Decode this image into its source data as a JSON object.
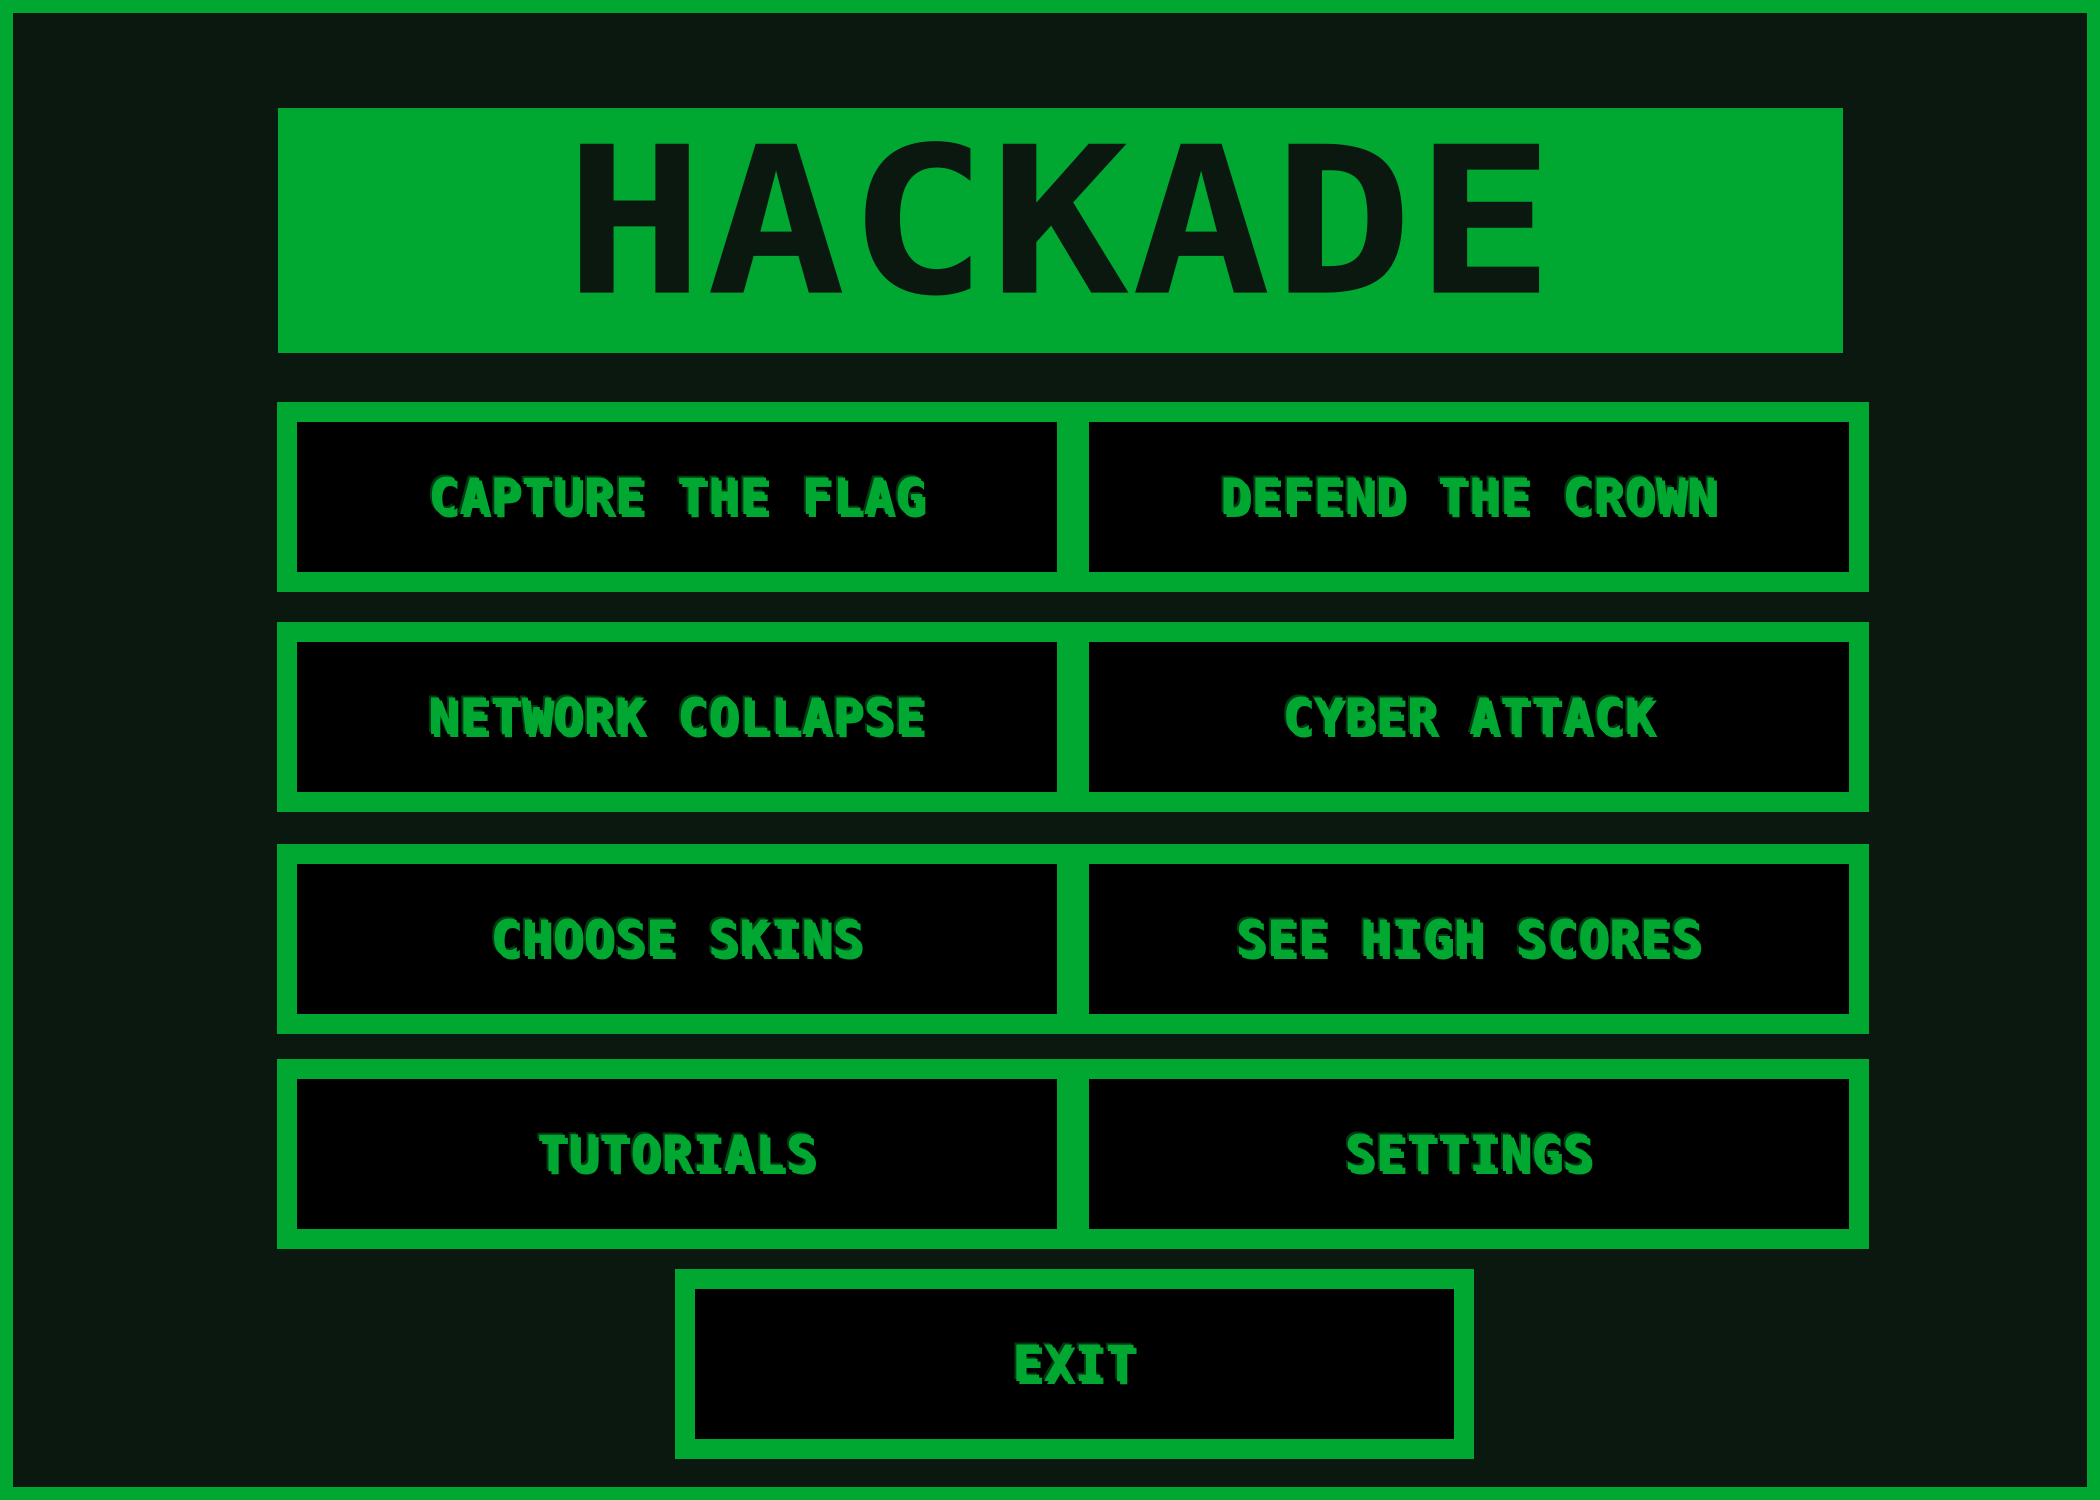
{
  "title": "HACKADE",
  "colors": {
    "accent": "#00a832",
    "background": "#0a1810",
    "button_fill": "#000000"
  },
  "menu": {
    "buttons": [
      {
        "label": "CAPTURE THE FLAG"
      },
      {
        "label": "DEFEND THE CROWN"
      },
      {
        "label": "NETWORK COLLAPSE"
      },
      {
        "label": "CYBER ATTACK"
      },
      {
        "label": "CHOOSE SKINS"
      },
      {
        "label": "SEE HIGH SCORES"
      },
      {
        "label": "TUTORIALS"
      },
      {
        "label": "SETTINGS"
      }
    ],
    "exit_label": "EXIT"
  }
}
